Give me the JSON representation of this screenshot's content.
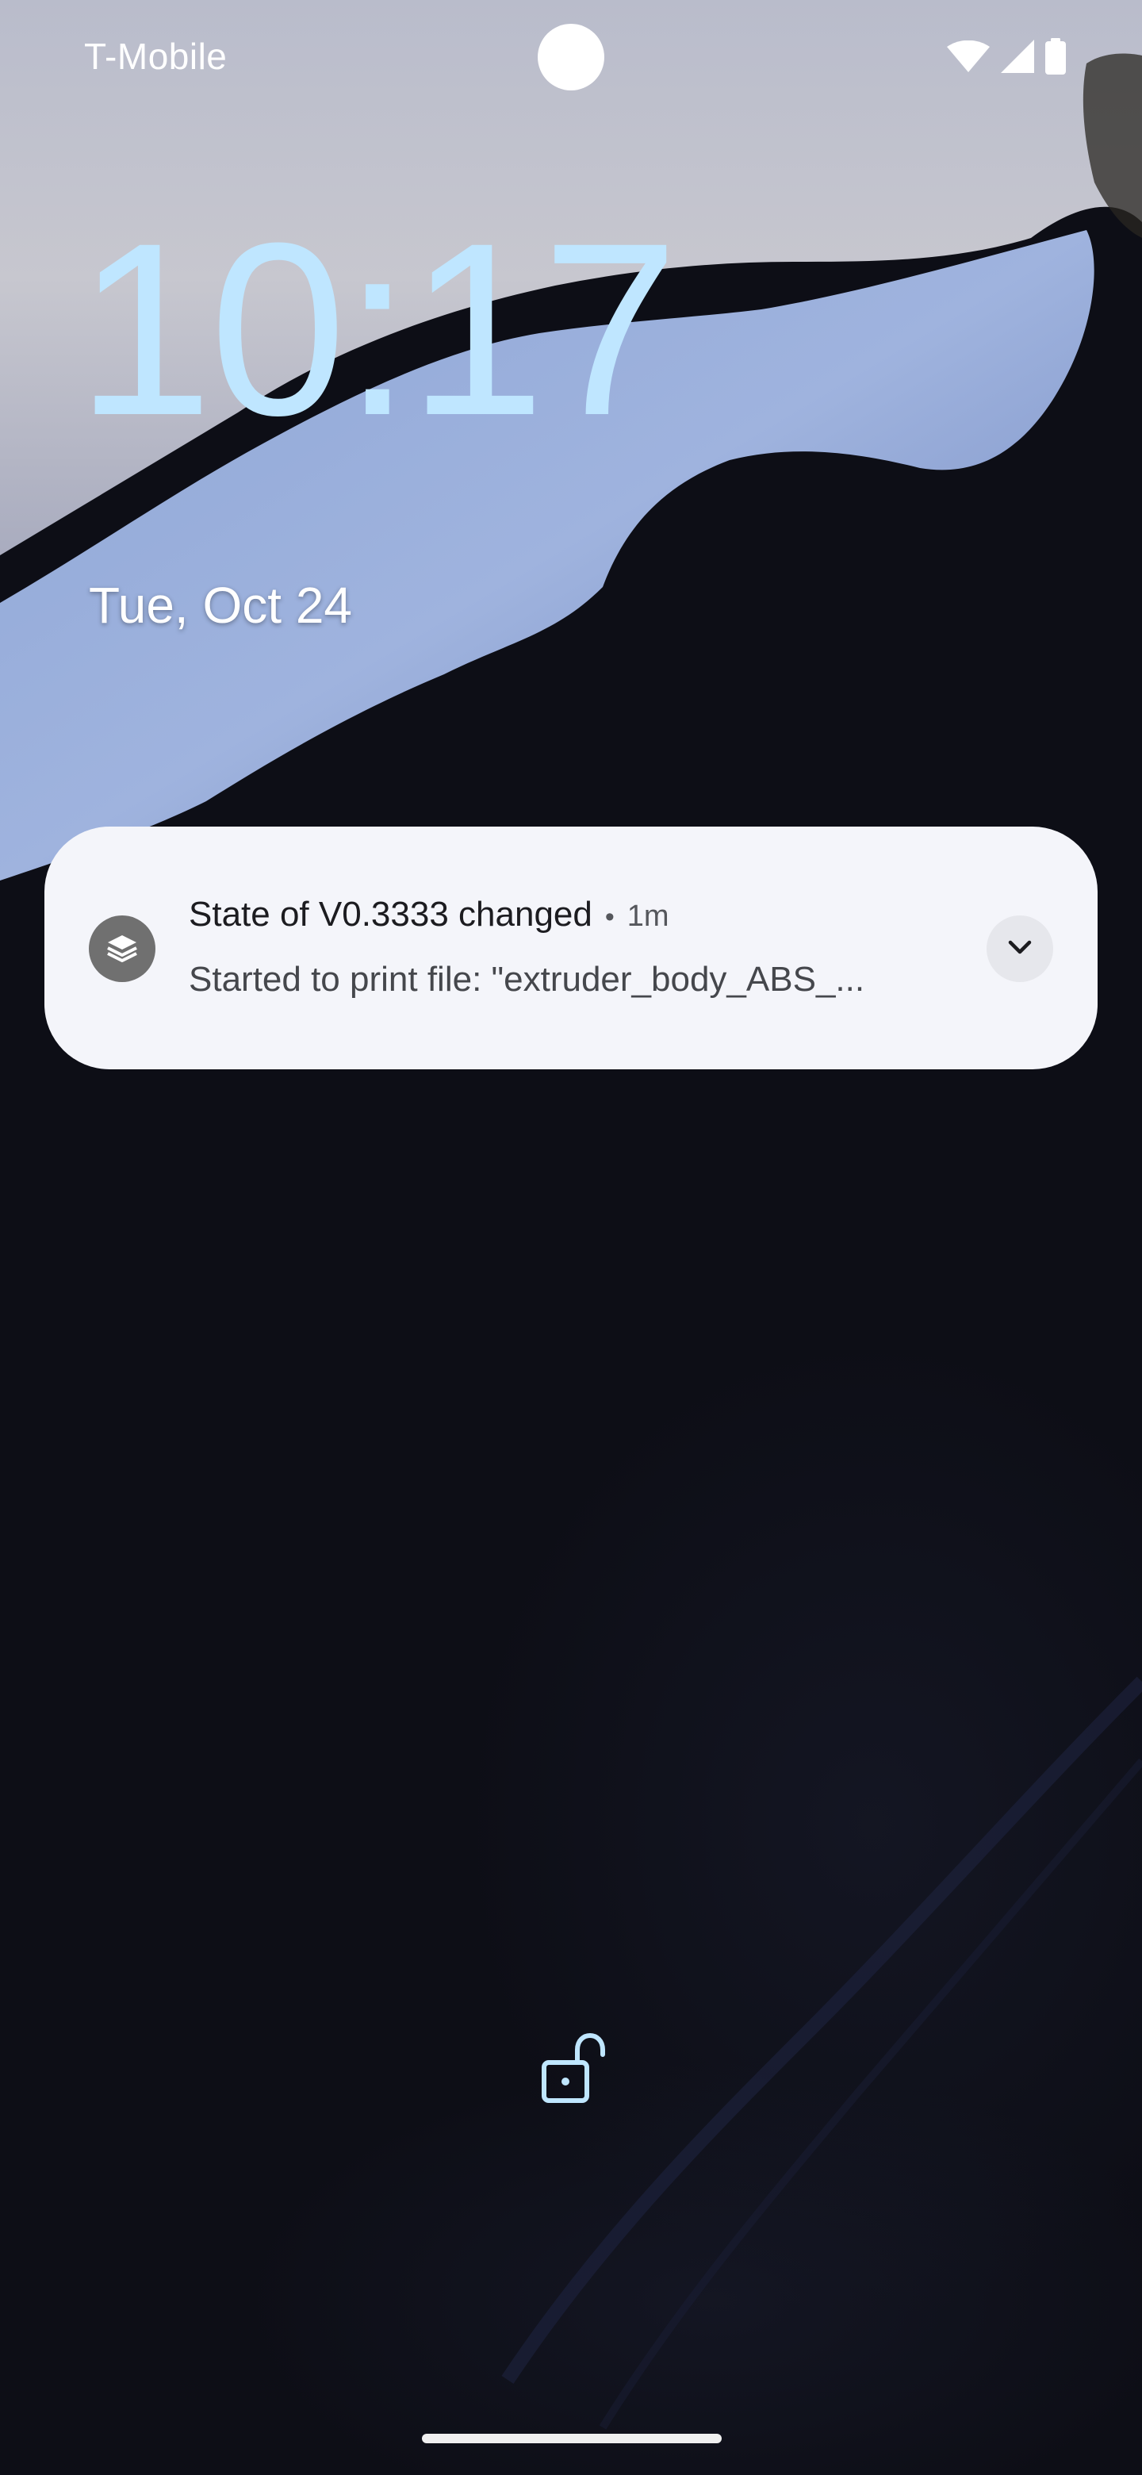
{
  "status_bar": {
    "carrier": "T-Mobile",
    "icons": [
      "wifi-icon",
      "cellular-signal-icon",
      "battery-icon"
    ]
  },
  "lockscreen": {
    "time": "10:17",
    "date": "Tue, Oct 24"
  },
  "notification": {
    "app_icon": "layers-icon",
    "title": "State of V0.3333 changed",
    "separator": "•",
    "time_ago": "1m",
    "body": "Started to print file: \"extruder_body_ABS_...",
    "expand_icon": "chevron-down-icon"
  },
  "colors": {
    "clock": "#bfe6ff",
    "notification_bg": "#f4f5fa",
    "background": "#0d0e16"
  }
}
